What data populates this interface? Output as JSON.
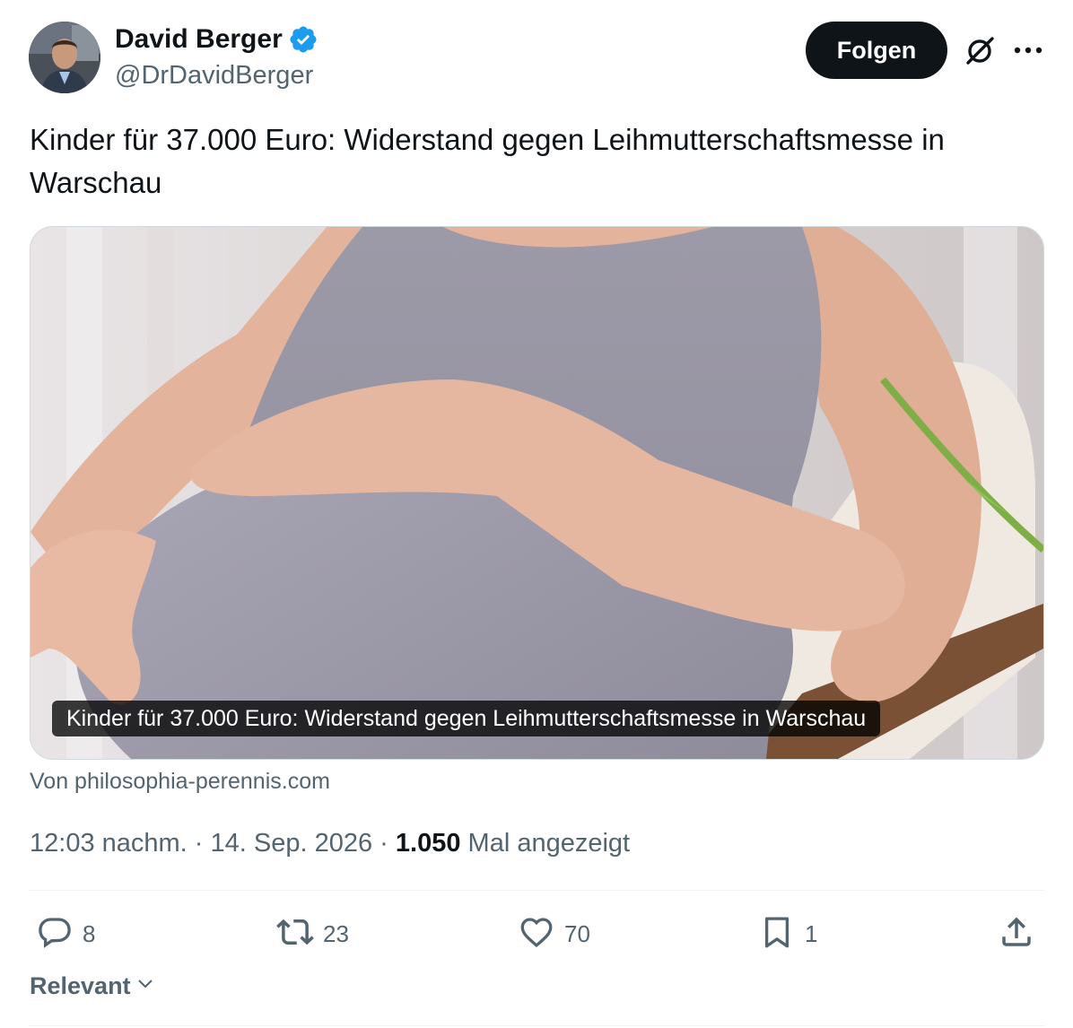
{
  "author": {
    "name": "David Berger",
    "handle": "@DrDavidBerger",
    "verified": true
  },
  "header": {
    "follow_label": "Folgen",
    "icons": [
      "verified-badge-icon",
      "grok-icon",
      "more-icon"
    ]
  },
  "tweet": {
    "text": "Kinder für 37.000 Euro: Widerstand gegen Leihmutterschaftsmesse in Warschau"
  },
  "card": {
    "caption": "Kinder für 37.000 Euro: Widerstand gegen Leihmutterschaftsmesse in Warschau",
    "source": "Von philosophia-perennis.com"
  },
  "meta": {
    "time": "12:03 nachm.",
    "separator1": " · ",
    "date": "14. Sep. 2026",
    "separator2": " · ",
    "views_count": "1.050",
    "views_label": " Mal angezeigt"
  },
  "actions": {
    "replies": "8",
    "reposts": "23",
    "likes": "70",
    "bookmarks": "1"
  },
  "sort": {
    "label": "Relevant"
  },
  "colors": {
    "text_primary": "#0f1419",
    "text_secondary": "#536471",
    "verified_blue": "#1d9bf0",
    "divider": "#eff3f4"
  }
}
